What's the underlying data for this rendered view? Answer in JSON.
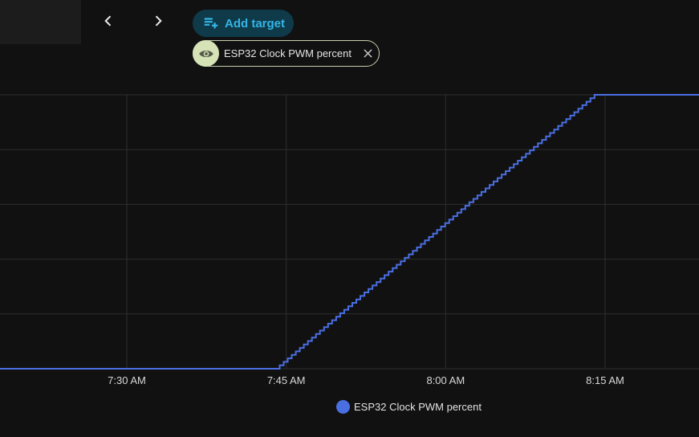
{
  "toolbar": {
    "add_target_label": "Add target",
    "prev_icon": "chevron-left-icon",
    "next_icon": "chevron-right-icon",
    "add_icon": "playlist-plus-icon"
  },
  "target_chip": {
    "label": "ESP32 Clock PWM percent",
    "icon": "eye-icon",
    "remove_icon": "close-icon"
  },
  "colors": {
    "background": "#111111",
    "series": "#4a6fe3",
    "grid": "#2e2e2e",
    "accent": "#33b5e5"
  },
  "chart_data": {
    "type": "line",
    "step": true,
    "title": "",
    "xlabel": "",
    "ylabel": "",
    "x_ticks": [
      "7:30 AM",
      "7:45 AM",
      "8:00 AM",
      "8:15 AM"
    ],
    "grid": true,
    "legend_position": "bottom",
    "y_tick_labels_visible": false,
    "series": [
      {
        "name": "ESP32 Clock PWM percent",
        "points": [
          {
            "x": "7:18 AM",
            "y": 0
          },
          {
            "x": "7:44 AM",
            "y": 0
          },
          {
            "x": "8:14 AM",
            "y": 100
          },
          {
            "x": "8:26 AM",
            "y": 100
          }
        ]
      }
    ],
    "ylim": [
      0,
      100
    ]
  }
}
